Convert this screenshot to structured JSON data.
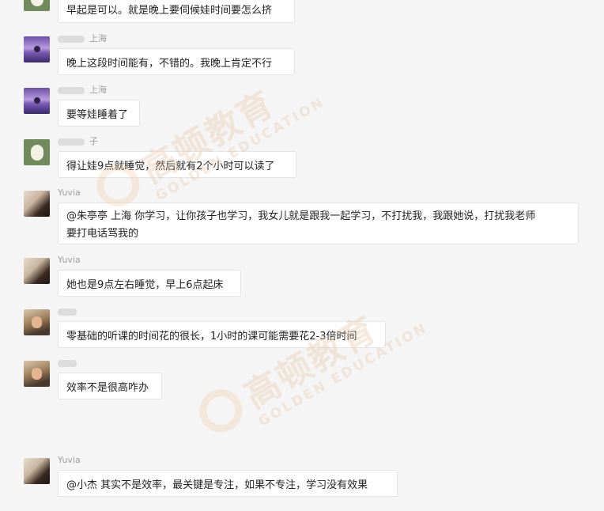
{
  "messages": [
    {
      "id": "m0",
      "avatar": "dog",
      "name": "",
      "text": "早起是可以。就是晚上要伺候娃时间要怎么挤"
    },
    {
      "id": "m1",
      "avatar": "lavender",
      "name": "上海",
      "text": "晚上这段时间能有，不错的。我晚上肯定不行"
    },
    {
      "id": "m2",
      "avatar": "lavender",
      "name": "上海",
      "text": "要等娃睡着了"
    },
    {
      "id": "m3",
      "avatar": "dog",
      "name": "子",
      "text": "得让娃9点就睡觉，然后就有2个小时可以读了"
    },
    {
      "id": "m4",
      "avatar": "girl",
      "name": "Yuvia",
      "text_line1": "@朱亭亭 上海 你学习，让你孩子也学习，我女儿就是跟我一起学习，不打扰我，我跟她说，打扰我老师",
      "text_line2": "要打电话骂我的"
    },
    {
      "id": "m5",
      "avatar": "girl",
      "name": "Yuvia",
      "text": "她也是9点左右睡觉，早上6点起床"
    },
    {
      "id": "m6",
      "avatar": "man",
      "name": "",
      "text": "零基础的听课的时间花的很长，1小时的课可能需要花2-3倍时间"
    },
    {
      "id": "m7",
      "avatar": "man",
      "name": "",
      "text": "效率不是很高咋办"
    },
    {
      "id": "m8",
      "avatar": "girl",
      "name": "Yuvia",
      "text": "@小杰 其实不是效率，最关键是专注，如果不专注，学习没有效果"
    }
  ],
  "watermark": {
    "cn": "高顿教育",
    "en": "GOLDEN EDUCATION"
  }
}
